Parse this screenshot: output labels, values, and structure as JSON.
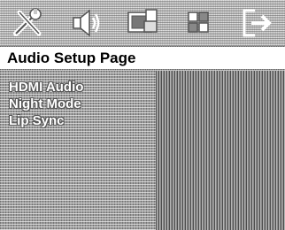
{
  "tabs": [
    {
      "icon": "tools-icon"
    },
    {
      "icon": "speaker-icon"
    },
    {
      "icon": "video-icon"
    },
    {
      "icon": "preference-icon"
    },
    {
      "icon": "exit-icon"
    }
  ],
  "page_title": "Audio Setup Page",
  "menu": {
    "items": [
      {
        "label": "HDMI Audio"
      },
      {
        "label": "Night Mode"
      },
      {
        "label": "Lip Sync"
      }
    ]
  },
  "colors": {
    "title_bar_bg": "#ffffff",
    "title_text": "#000000",
    "menu_text": "#ffffff",
    "panel_bg": "#9a9a9a"
  }
}
